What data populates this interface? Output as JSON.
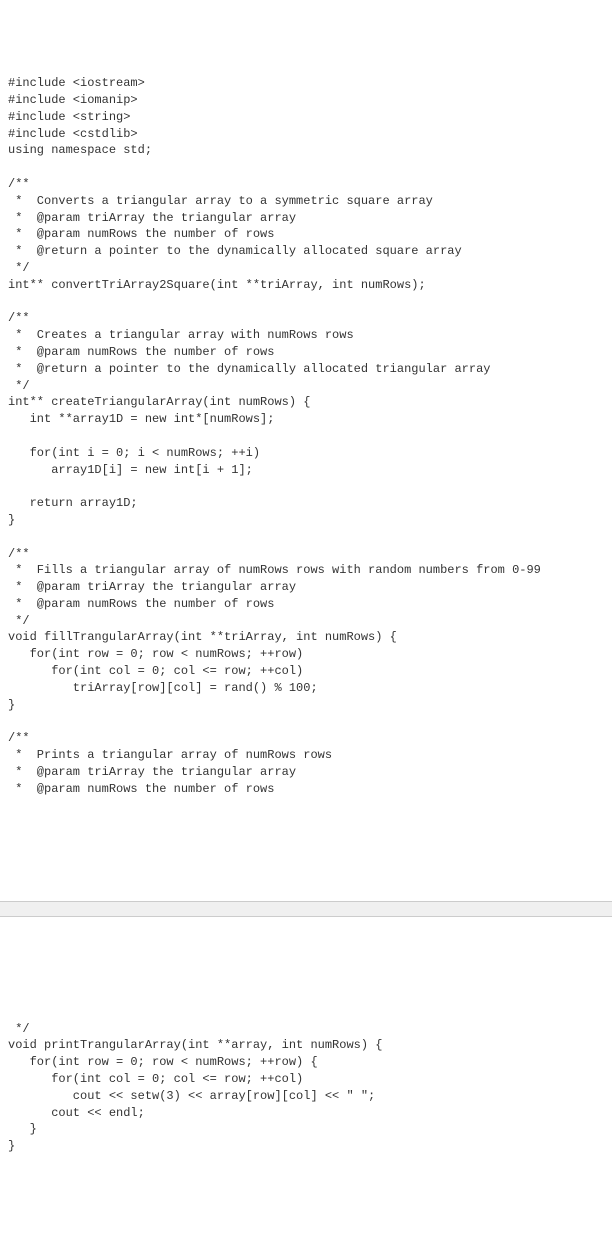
{
  "code1": "#include <iostream>\n#include <iomanip>\n#include <string>\n#include <cstdlib>\nusing namespace std;\n\n/**\n *  Converts a triangular array to a symmetric square array\n *  @param triArray the triangular array\n *  @param numRows the number of rows\n *  @return a pointer to the dynamically allocated square array\n */\nint** convertTriArray2Square(int **triArray, int numRows);\n\n/**\n *  Creates a triangular array with numRows rows\n *  @param numRows the number of rows\n *  @return a pointer to the dynamically allocated triangular array\n */\nint** createTriangularArray(int numRows) {\n   int **array1D = new int*[numRows];\n\n   for(int i = 0; i < numRows; ++i)\n      array1D[i] = new int[i + 1];\n\n   return array1D;\n}\n\n/**\n *  Fills a triangular array of numRows rows with random numbers from 0-99\n *  @param triArray the triangular array\n *  @param numRows the number of rows\n */\nvoid fillTrangularArray(int **triArray, int numRows) {\n   for(int row = 0; row < numRows; ++row)\n      for(int col = 0; col <= row; ++col)\n         triArray[row][col] = rand() % 100;\n}\n\n/**\n *  Prints a triangular array of numRows rows\n *  @param triArray the triangular array\n *  @param numRows the number of rows",
  "code2": " */\nvoid printTrangularArray(int **array, int numRows) {\n   for(int row = 0; row < numRows; ++row) {\n      for(int col = 0; col <= row; ++col)\n         cout << setw(3) << array[row][col] << \" \";\n      cout << endl;\n   }\n}"
}
